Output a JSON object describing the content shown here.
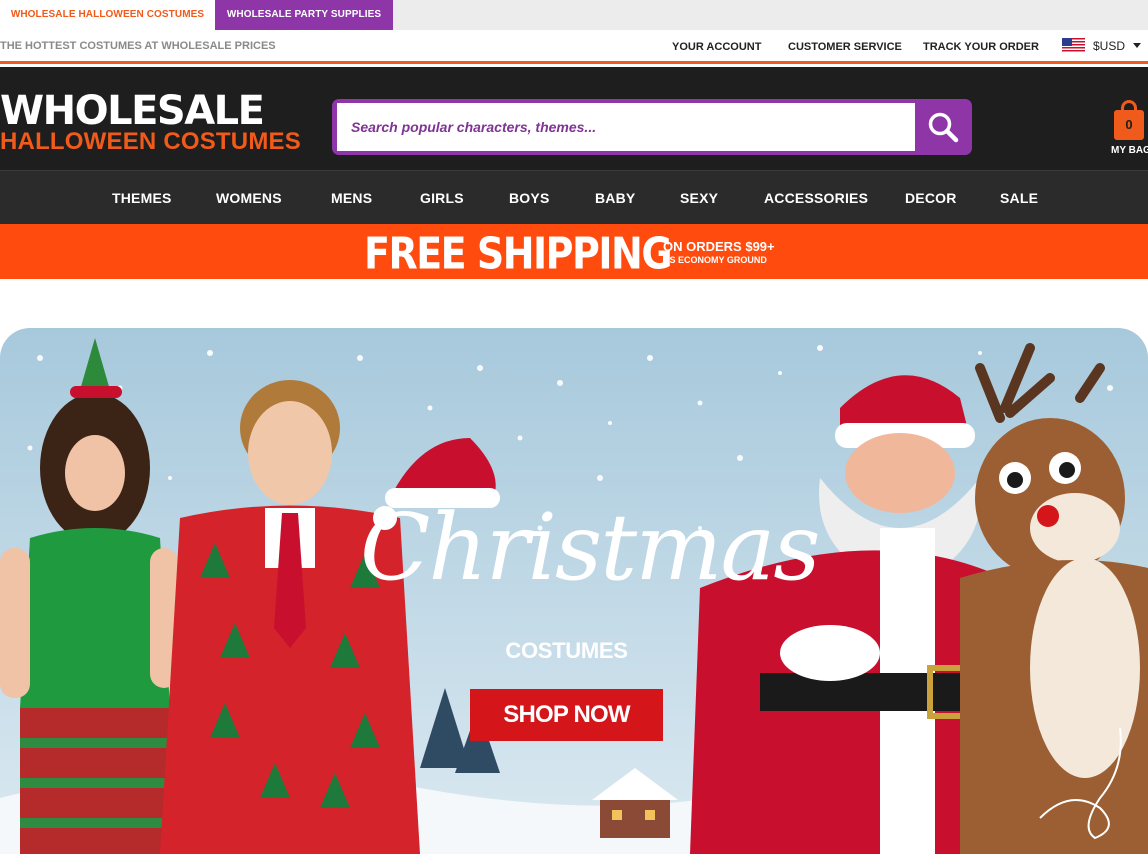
{
  "tabs": [
    {
      "label": "WHOLESALE HALLOWEEN COSTUMES",
      "active": true,
      "color": "#f05a1a"
    },
    {
      "label": "WHOLESALE PARTY SUPPLIES",
      "active": false,
      "color": "#8e36a8"
    }
  ],
  "utility": {
    "tagline": "THE HOTTEST COSTUMES AT WHOLESALE PRICES",
    "links": [
      "YOUR ACCOUNT",
      "CUSTOMER SERVICE",
      "TRACK YOUR ORDER"
    ],
    "currency": "$USD",
    "currency_icon": "us-flag-icon"
  },
  "header": {
    "logo_line1": "WHOLESALE",
    "logo_line2": "HALLOWEEN COSTUMES",
    "search_placeholder": "Search popular characters, themes...",
    "bag_count": "0",
    "bag_label": "MY BAG"
  },
  "nav": [
    "THEMES",
    "WOMENS",
    "MENS",
    "GIRLS",
    "BOYS",
    "BABY",
    "SEXY",
    "ACCESSORIES",
    "DECOR",
    "SALE"
  ],
  "shipping": {
    "headline": "FREE SHIPPING",
    "line1": "ON ORDERS $99+",
    "line2": "US ECONOMY GROUND"
  },
  "hero": {
    "script": "Christmas",
    "subtitle": "COSTUMES",
    "cta": "SHOP NOW"
  },
  "colors": {
    "brand_orange": "#f05a1a",
    "brand_purple": "#8e36a8",
    "header_dark": "#1e1e1e",
    "banner_orange": "#ff4b0e",
    "cta_red": "#d4161b"
  }
}
